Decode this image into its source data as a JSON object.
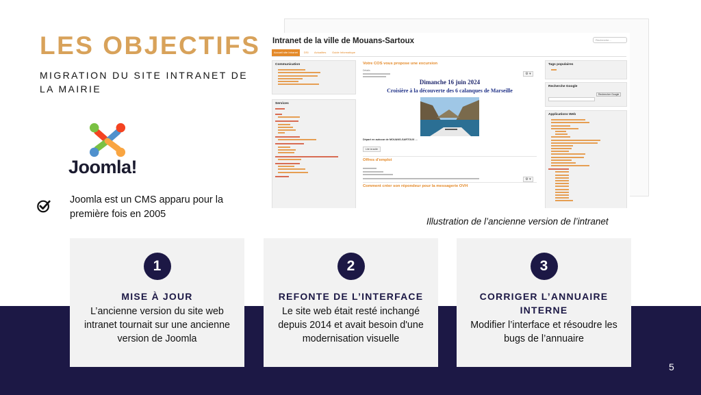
{
  "slide": {
    "title": "LES OBJECTIFS",
    "subtitle": "MIGRATION DU SITE INTRANET DE LA MAIRIE",
    "joomla_logo_text": "Joomla!",
    "joomla_desc": "Joomla est un CMS apparu pour la première fois en 2005",
    "caption": "Illustration de l’ancienne version de l’intranet",
    "page_number": "5"
  },
  "screenshot": {
    "title": "Intranet de la ville de Mouans-Sartoux",
    "search_placeholder": "Recherche...",
    "nav": [
      "Accueil site Intranet",
      "DSI",
      "Actualites",
      "Guide Informatique"
    ],
    "left_panels": [
      {
        "title": "Communication"
      },
      {
        "title": "Services"
      }
    ],
    "center_heading": "Votre COS vous propose une excursion",
    "center_meta": "Détails",
    "event_date": "Dimanche 16 juin 2024",
    "event_title": "Croisière à la découverte des 6 calanques de Marseille",
    "departure": "Départ en autocar de MOUANS-SARTOUX ...",
    "read_more": "Lire la suite",
    "jobs_heading": "Offres d'emploi",
    "responder_heading": "Comment créer son répondeur pour la messagerie OVH",
    "right_panels": [
      {
        "title": "Tags populaires"
      },
      {
        "title": "Recherche Google"
      },
      {
        "title": "Applications Web"
      }
    ],
    "google_button": "Rechercher Google",
    "gear": "⚙ ▾"
  },
  "cards": [
    {
      "number": "1",
      "title": "MISE À JOUR",
      "text": "L’ancienne version du site web intranet tournait sur une ancienne version de Joomla"
    },
    {
      "number": "2",
      "title": "REFONTE DE L’INTERFACE",
      "text": "Le site web était resté inchangé depuis 2014 et avait besoin d'une modernisation visuelle"
    },
    {
      "number": "3",
      "title": "CORRIGER L’ANNUAIRE INTERNE",
      "text": "Modifier l’interface et résoudre les bugs de l’annuaire"
    }
  ],
  "colors": {
    "title": "#d8a25a",
    "navy": "#1c1845",
    "card_bg": "#f2f2f2",
    "intranet_orange": "#e48a2a"
  },
  "icons": [
    "joomla-logo-icon",
    "check-circle-icon",
    "gear-icon"
  ]
}
